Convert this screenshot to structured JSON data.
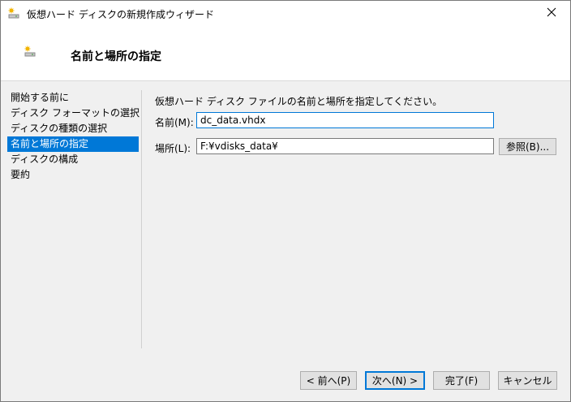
{
  "window": {
    "title": "仮想ハード ディスクの新規作成ウィザード"
  },
  "header": {
    "title": "名前と場所の指定"
  },
  "nav": {
    "items": [
      "開始する前に",
      "ディスク フォーマットの選択",
      "ディスクの種類の選択",
      "名前と場所の指定",
      "ディスクの構成",
      "要約"
    ],
    "selected_index": 3
  },
  "content": {
    "description": "仮想ハード ディスク ファイルの名前と場所を指定してください。",
    "name_label": "名前(M):",
    "name_value": "dc_data.vhdx",
    "location_label": "場所(L):",
    "location_value": "F:¥vdisks_data¥",
    "browse_label": "参照(B)..."
  },
  "buttons": {
    "back": "< 前へ(P)",
    "next": "次へ(N) >",
    "finish": "完了(F)",
    "cancel": "キャンセル"
  },
  "icons": {
    "title": "disk-icon",
    "header": "disk-icon",
    "close": "close-icon"
  },
  "colors": {
    "accent": "#0078d7",
    "selected_bg": "#0078d7"
  }
}
